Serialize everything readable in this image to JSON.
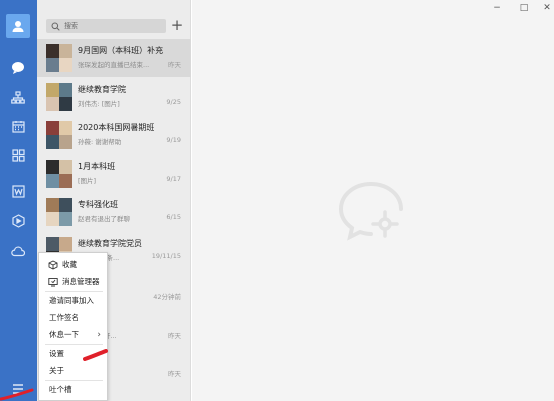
{
  "search": {
    "placeholder": "搜索",
    "add_label": "+"
  },
  "chats": [
    {
      "name": "9月国网（本科班）补充",
      "preview": "张琛发起的直播已结束...",
      "time": "昨天"
    },
    {
      "name": "继续教育学院",
      "preview": "刘伟杰: [图片]",
      "time": "9/25"
    },
    {
      "name": "2020本科国网暑期班",
      "preview": "孙薇: 谢谢帮助",
      "time": "9/19"
    },
    {
      "name": "1月本科班",
      "preview": "[图片]",
      "time": "9/17"
    },
    {
      "name": "专科强化班",
      "preview": "赵君有退出了群聊",
      "time": "6/15"
    },
    {
      "name": "继续教育学院党员",
      "preview": "[回复了一条...",
      "time": "19/11/15"
    },
    {
      "name": "",
      "preview": "",
      "time": "42分钟前"
    },
    {
      "name": "",
      "preview": "技术培训开...",
      "time": "昨天"
    },
    {
      "name": "",
      "preview": "",
      "time": "昨天"
    }
  ],
  "menu": {
    "favorites": "收藏",
    "message_manager": "消息管理器",
    "invite": "邀请同事加入",
    "work_signature": "工作签名",
    "rest": "休息一下",
    "rest_arrow": "›",
    "settings": "设置",
    "about": "关于",
    "feedback": "吐个槽"
  },
  "window": {
    "minimize": "−",
    "maximize": "□",
    "close": "✕"
  },
  "colors": {
    "rail": "#3a72c6",
    "accent_mark": "#e0202a"
  }
}
